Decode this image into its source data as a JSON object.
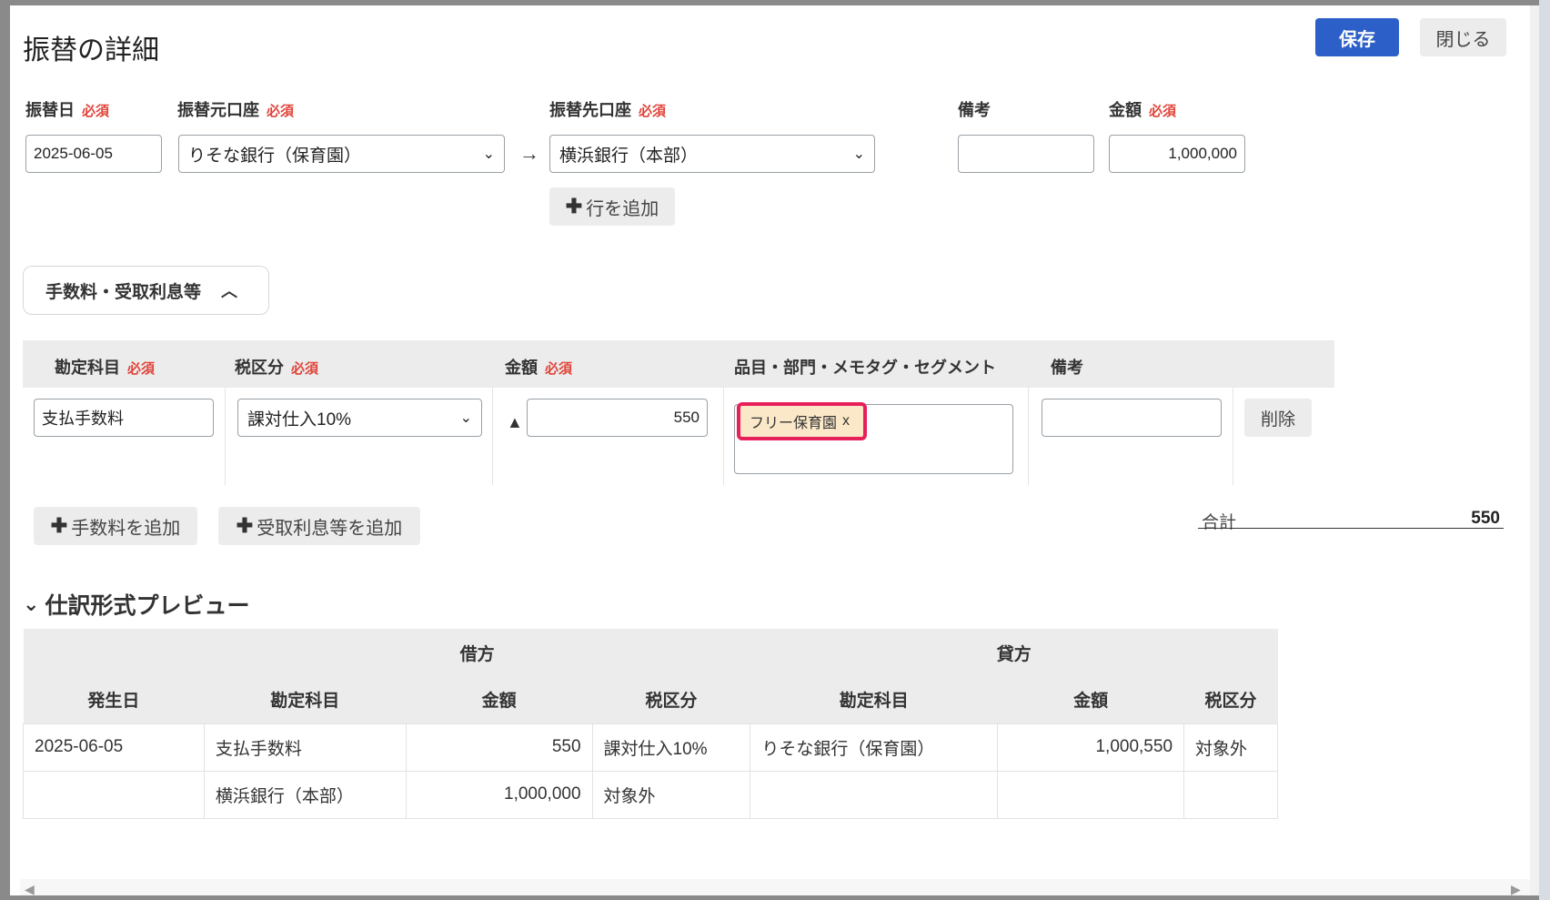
{
  "dialog": {
    "title": "振替の詳細",
    "save_label": "保存",
    "close_label": "閉じる"
  },
  "transfer": {
    "date_label": "振替日",
    "required": "必須",
    "date_value": "2025-06-05",
    "from_label": "振替元口座",
    "from_value": "りそな銀行（保育園）",
    "to_label": "振替先口座",
    "to_value": "横浜銀行（本部）",
    "memo_label": "備考",
    "memo_value": "",
    "amount_label": "金額",
    "amount_value": "1,000,000",
    "add_row_label": "行を追加"
  },
  "fees": {
    "toggle_label": "手数料・受取利息等",
    "headers": {
      "account": "勘定科目",
      "tax": "税区分",
      "amount": "金額",
      "tags": "品目・部門・メモタグ・セグメント",
      "memo": "備考"
    },
    "row": {
      "account": "支払手数料",
      "tax": "課対仕入10%",
      "sign": "▲",
      "amount": "550",
      "tag": "フリー保育園",
      "tag_remove": "x",
      "memo": "",
      "delete_label": "削除"
    },
    "add_fee_label": "手数料を追加",
    "add_interest_label": "受取利息等を追加",
    "total_label": "合計",
    "total_value": "550"
  },
  "preview": {
    "title": "仕訳形式プレビュー",
    "debit_label": "借方",
    "credit_label": "貸方",
    "columns": {
      "date": "発生日",
      "debit_account": "勘定科目",
      "debit_amount": "金額",
      "debit_tax": "税区分",
      "credit_account": "勘定科目",
      "credit_amount": "金額",
      "credit_tax": "税区分"
    },
    "rows": [
      {
        "date": "2025-06-05",
        "debit_account": "支払手数料",
        "debit_amount": "550",
        "debit_tax": "課対仕入10%",
        "credit_account": "りそな銀行（保育園）",
        "credit_amount": "1,000,550",
        "credit_tax": "対象外"
      },
      {
        "date": "",
        "debit_account": "横浜銀行（本部）",
        "debit_amount": "1,000,000",
        "debit_tax": "対象外",
        "credit_account": "",
        "credit_amount": "",
        "credit_tax": ""
      }
    ]
  },
  "colors": {
    "primary": "#2c5fc7",
    "required": "#e0443a",
    "tag_bg": "#fbe8c8",
    "highlight": "#e8205a"
  }
}
